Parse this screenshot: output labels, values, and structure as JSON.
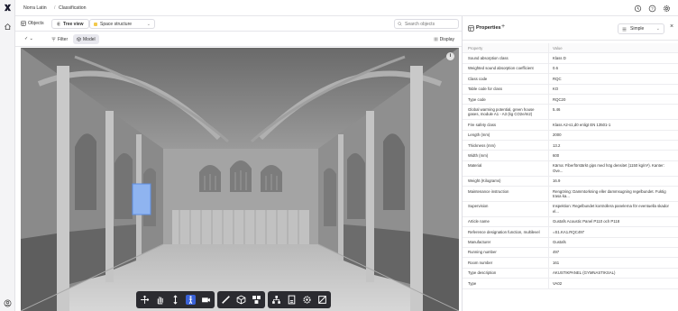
{
  "breadcrumb": {
    "project": "Norra Latin",
    "page": "Classification"
  },
  "subbar": {
    "objects_label": "Objects",
    "tree_view_label": "Tree view",
    "space_selector_value": "Space structure",
    "search_placeholder": "Search objects"
  },
  "toolbar": {
    "check_label": "✓ ⌄",
    "filter_label": "Filter",
    "model_label": "Model",
    "display_label": "Display"
  },
  "viewer": {
    "info_label": "i"
  },
  "viewer_tools": {
    "group1": [
      "move-icon",
      "hand-pan-icon",
      "vertical-move-icon",
      "walk-person-icon",
      "camera-icon"
    ],
    "group2": [
      "measure-ruler-icon",
      "section-box-icon",
      "explode-cubes-icon"
    ],
    "group3": [
      "tree-structure-icon",
      "properties-doc-icon",
      "settings-gear-icon",
      "fullscreen-icon"
    ],
    "active": "walk-person-icon"
  },
  "properties": {
    "title": "Properties",
    "view_mode": "Simple",
    "header": {
      "key": "Property",
      "value": "Value"
    },
    "rows": [
      {
        "key": "Sound absorption class",
        "value": "Klass D"
      },
      {
        "key": "Weighted sound absorption coefficient",
        "value": "0.6"
      },
      {
        "key": "Class code",
        "value": "RQC"
      },
      {
        "key": "Table code for class",
        "value": "KO"
      },
      {
        "key": "Type code",
        "value": "RQC20"
      },
      {
        "key": "Global warming potential, green house gases, module A1 - A3 (kg CO2e/m2)",
        "value": "5.46"
      },
      {
        "key": "Fire safety class",
        "value": "Klass A2-s1,d0 enligt EN 13501-1"
      },
      {
        "key": "Length (mm)",
        "value": "2000"
      },
      {
        "key": "Thickness (mm)",
        "value": "13.2"
      },
      {
        "key": "Width (mm)",
        "value": "600"
      },
      {
        "key": "Material",
        "value": "Kärna: Fiberförstärkt gips med hög densitet (1150 kg/m³). Kanter: Ove..."
      },
      {
        "key": "Weight (Kilograms)",
        "value": "16.9"
      },
      {
        "key": "Maintenance instruction",
        "value": "Rengöring: Dammtorkning eller dammsugning regelbundet. Fuktig trasa ka..."
      },
      {
        "key": "Supervision",
        "value": "Inspektion: Regelbundet kontrollera panelerna för eventuella skador el..."
      },
      {
        "key": "Article name",
        "value": "Gustafs Acoustic Panel P110 och P118"
      },
      {
        "key": "Reference designation function, multilevel",
        "value": "=S1.KA1.RQC497"
      },
      {
        "key": "Manufacturer",
        "value": "Gustafs"
      },
      {
        "key": "Running number",
        "value": "497"
      },
      {
        "key": "Room number",
        "value": "161"
      },
      {
        "key": "Type description",
        "value": "AKUSTIKPANEL (GYMNASTIKSAL)"
      },
      {
        "key": "Type",
        "value": "VA02"
      }
    ]
  },
  "colors": {
    "accent": "#3a62d8",
    "toolbar_bg": "#2b2b30",
    "space_dot": "#f2c94c"
  }
}
